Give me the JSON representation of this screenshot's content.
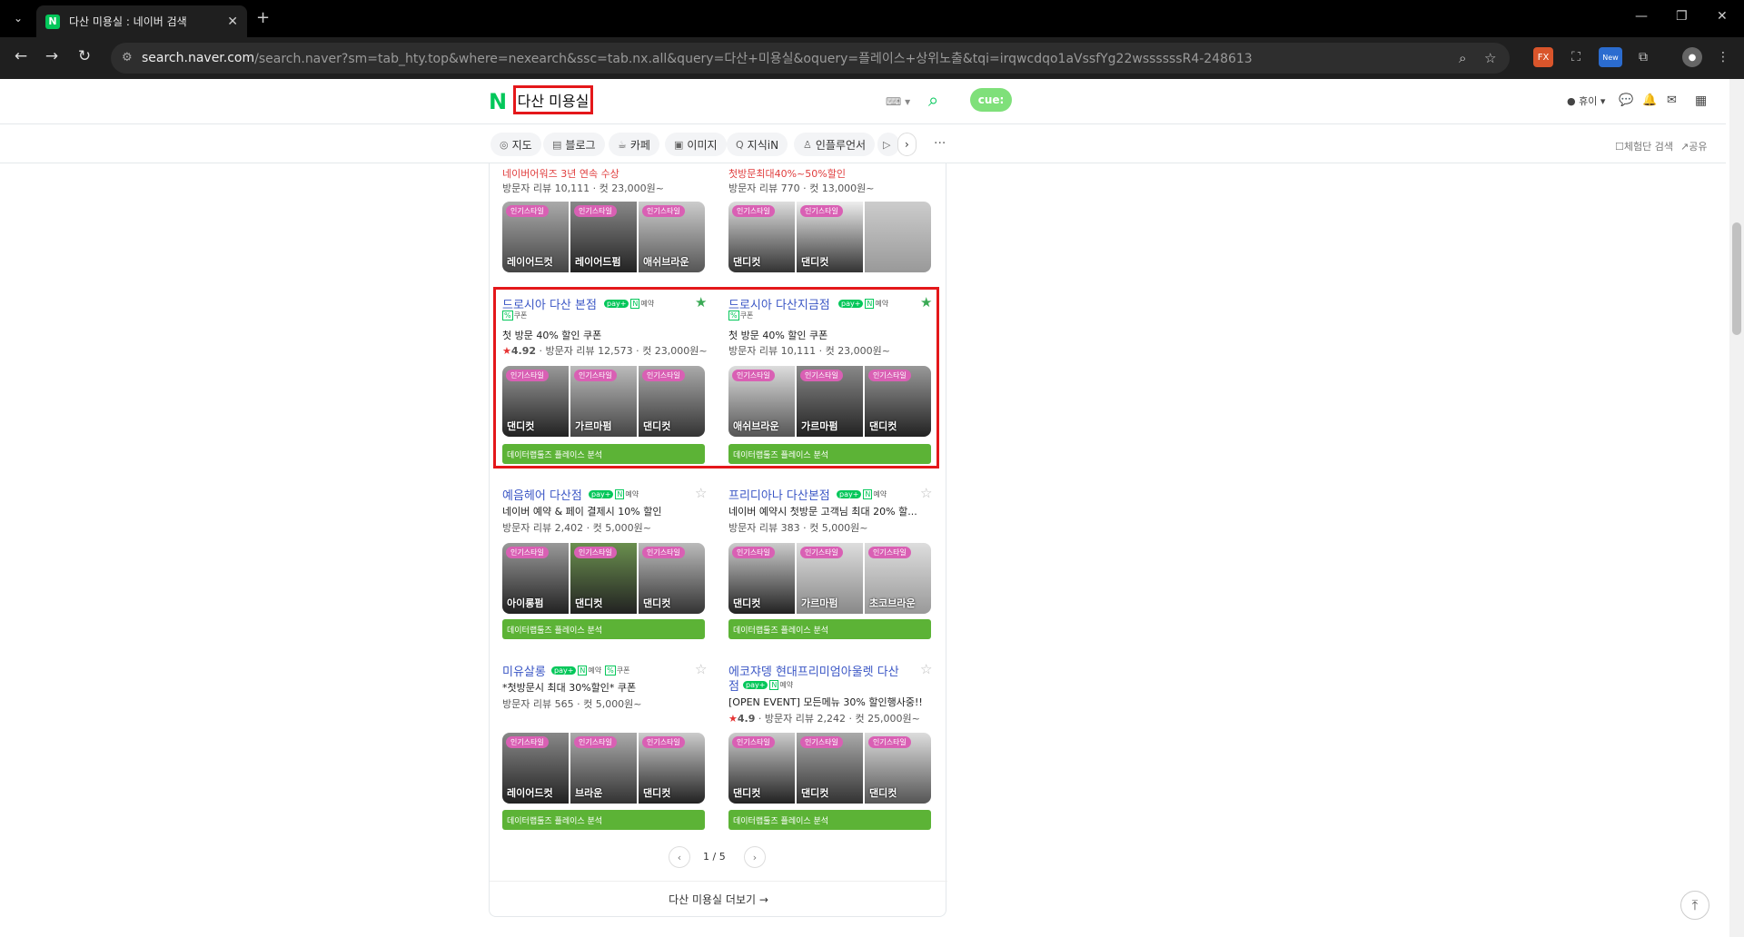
{
  "browser": {
    "tab_title": "다산 미용실 : 네이버 검색",
    "favicon_letter": "N",
    "url_host": "search.naver.com",
    "url_rest": "/search.naver?sm=tab_hty.top&where=nexearch&ssc=tab.nx.all&query=다산+미용실&oquery=플레이스+상위노출&tqi=irqwcdqo1aVssfYg22wssssssR4-248613",
    "ext_new_label": "New",
    "ext_fx_label": "FX"
  },
  "header": {
    "logo": "N",
    "query": "다산 미용실",
    "cue_label": "cue:",
    "user_label": "휴이"
  },
  "search_tabs": [
    {
      "icon": "◎",
      "label": "지도"
    },
    {
      "icon": "▤",
      "label": "블로그"
    },
    {
      "icon": "☕",
      "label": "카페"
    },
    {
      "icon": "▣",
      "label": "이미지"
    },
    {
      "icon": "Q",
      "label": "지식iN"
    },
    {
      "icon": "♙",
      "label": "인플루언서"
    }
  ],
  "right_tools": {
    "experience": "체험단 검색",
    "share": "공유"
  },
  "badges": {
    "pay": "pay+",
    "n": "N",
    "reserve": "예약",
    "coupon": "쿠폰",
    "popular": "인기스타일",
    "datalab": "데이터랩툴즈 플레이스 분석"
  },
  "places": [
    {
      "name": "",
      "promo": "네이버어워즈 3년 연속 수상",
      "desc": "",
      "meta": "방문자 리뷰 10,111 · 컷 23,000원~",
      "thumbs": [
        "레이어드컷",
        "레이어드펌",
        "애쉬브라운"
      ],
      "starred": false,
      "badges": [],
      "datalab": false
    },
    {
      "name": "",
      "promo": "첫방문최대40%~50%할인",
      "desc": "",
      "meta": "방문자 리뷰 770 · 컷 13,000원~",
      "thumbs": [
        "댄디컷",
        "댄디컷",
        ""
      ],
      "starred": false,
      "badges": [],
      "datalab": false
    },
    {
      "name": "드로시아 다산 본점",
      "promo": "",
      "desc": "첫 방문 40% 할인 쿠폰",
      "rating": "4.92",
      "meta": "방문자 리뷰 12,573 · 컷 23,000원~",
      "thumbs": [
        "댄디컷",
        "가르마펌",
        "댄디컷"
      ],
      "starred": true,
      "badges": [
        "pay",
        "n",
        "coupon"
      ],
      "datalab": true
    },
    {
      "name": "드로시아 다산지금점",
      "promo": "",
      "desc": "첫 방문 40% 할인 쿠폰",
      "rating": "",
      "meta": "방문자 리뷰 10,111 · 컷 23,000원~",
      "thumbs": [
        "애쉬브라운",
        "가르마펌",
        "댄디컷"
      ],
      "starred": true,
      "badges": [
        "pay",
        "n",
        "coupon"
      ],
      "datalab": true
    },
    {
      "name": "예음헤어 다산점",
      "promo": "",
      "desc": "네이버 예약 & 페이 결제시 10% 할인",
      "rating": "",
      "meta": "방문자 리뷰 2,402 · 컷 5,000원~",
      "thumbs": [
        "아이롱펌",
        "댄디컷",
        "댄디컷"
      ],
      "starred": false,
      "badges": [
        "pay",
        "n"
      ],
      "datalab": true
    },
    {
      "name": "프리디아나 다산본점",
      "promo": "",
      "desc": "네이버 예약시 첫방문 고객님 최대 20% 할...",
      "rating": "",
      "meta": "방문자 리뷰 383 · 컷 5,000원~",
      "thumbs": [
        "댄디컷",
        "가르마펌",
        "초코브라운"
      ],
      "starred": false,
      "badges": [
        "pay",
        "n"
      ],
      "datalab": true
    },
    {
      "name": "미유살롱",
      "promo": "",
      "desc": "*첫방문시 최대 30%할인* 쿠폰",
      "rating": "",
      "meta": "방문자 리뷰 565 · 컷 5,000원~",
      "thumbs": [
        "레이어드컷",
        "브라운",
        "댄디컷"
      ],
      "starred": false,
      "badges": [
        "pay",
        "n",
        "coupon"
      ],
      "datalab": true
    },
    {
      "name": "에코쟈뎅 현대프리미엄아울렛 다산",
      "name2": "점",
      "promo": "",
      "desc": "[OPEN EVENT] 모든메뉴 30% 할인행사중!!",
      "rating": "4.9",
      "meta": "방문자 리뷰 2,242 · 컷 25,000원~",
      "thumbs": [
        "댄디컷",
        "댄디컷",
        "댄디컷"
      ],
      "starred": false,
      "badges": [
        "pay",
        "n"
      ],
      "datalab": true
    }
  ],
  "pager": {
    "text": "1 / 5"
  },
  "more_link": "다산 미용실 더보기 →",
  "colors": {
    "naver_green": "#03c75a",
    "highlight_red": "#e4171a",
    "datalab_green": "#5cb336",
    "popular_pink": "#d960b4",
    "link_blue": "#3a56c5"
  }
}
